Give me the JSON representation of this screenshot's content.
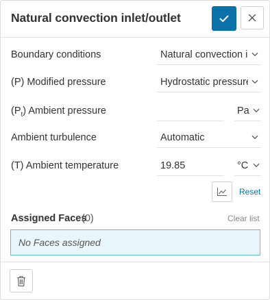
{
  "header": {
    "title": "Natural convection inlet/outlet"
  },
  "icons": {
    "confirm": "check-icon",
    "close": "close-icon",
    "chevron": "chevron-down-icon",
    "chart": "chart-icon",
    "delete": "trash-icon"
  },
  "colors": {
    "accent": "#0a72a9",
    "selection_bg": "#e9f6fa",
    "selection_border": "#5bbfd9"
  },
  "fields": {
    "boundary_conditions": {
      "label": "Boundary conditions",
      "value": "Natural convection inlet/outlet"
    },
    "modified_pressure": {
      "label": "(P) Modified pressure",
      "value": "Hydrostatic pressure"
    },
    "ambient_pressure": {
      "label_prefix": "(P",
      "label_sub": "t",
      "label_suffix": ") Ambient pressure",
      "value": "",
      "unit": "Pa"
    },
    "ambient_turbulence": {
      "label": "Ambient turbulence",
      "value": "Automatic"
    },
    "ambient_temperature": {
      "label": "(T) Ambient temperature",
      "value": "19.85",
      "unit": "°C"
    }
  },
  "actions": {
    "reset": "Reset"
  },
  "assigned": {
    "title": "Assigned Faces",
    "count": "(0)",
    "clear": "Clear list",
    "empty_text": "No Faces assigned"
  }
}
